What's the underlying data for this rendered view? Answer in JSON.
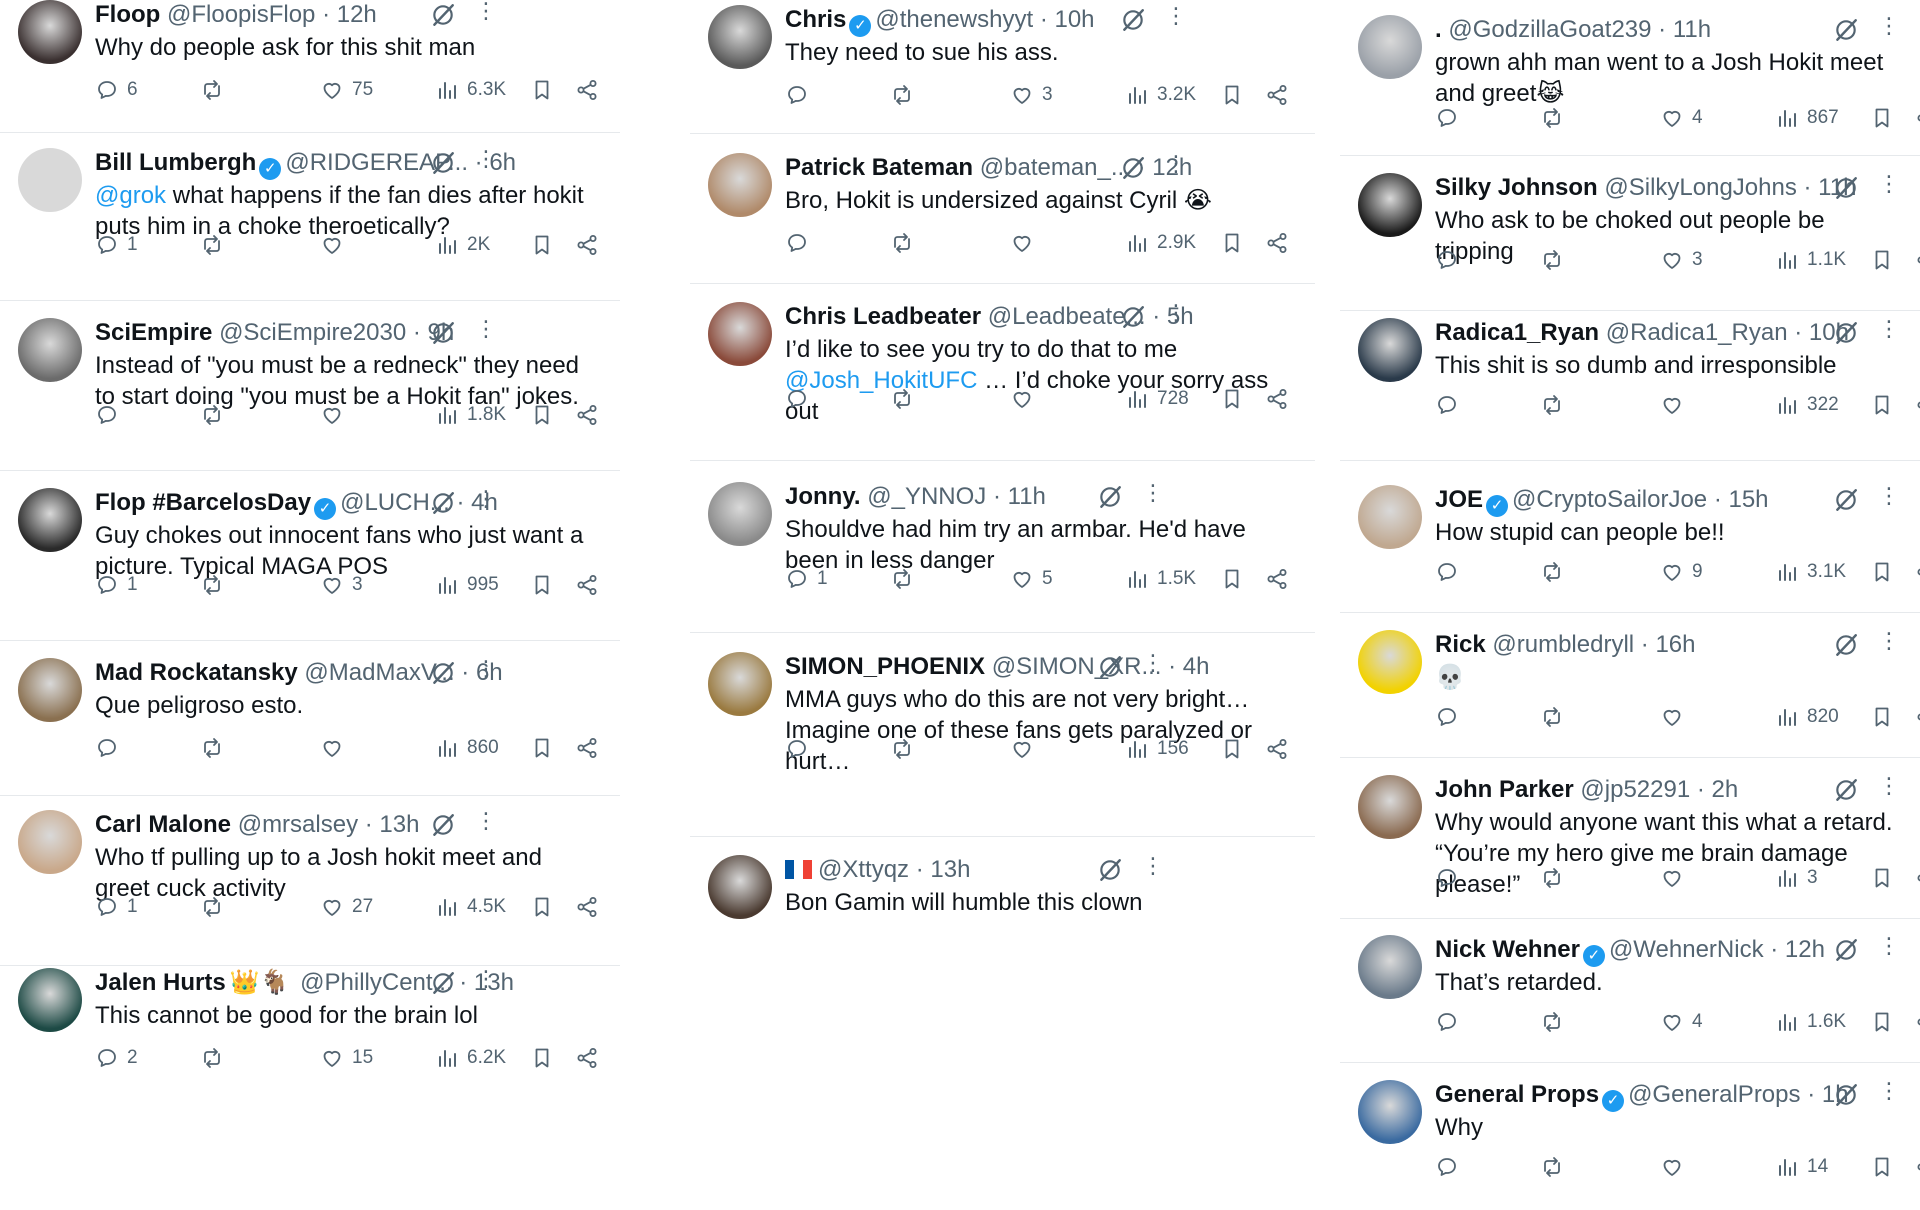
{
  "columns": [
    {
      "tweets": [
        {
          "name": "Floop",
          "verified": false,
          "extra": "",
          "handle": "@FloopisFlop",
          "time": "· 12h",
          "text": "Why do people ask for this shit man",
          "link": "",
          "text2": "",
          "replies": "6",
          "retweets": "",
          "likes": "75",
          "views": "6.3K",
          "avatar_color": "#3a3030"
        },
        {
          "name": "Bill Lumbergh",
          "verified": true,
          "extra": "",
          "handle": "@RIDGEREAP...",
          "time": "· 6h",
          "text": "",
          "link": "@grok",
          "text2": " what happens if the fan dies after hokit puts him in a choke theroetically?",
          "replies": "1",
          "retweets": "",
          "likes": "",
          "views": "2K",
          "avatar_color": "#d9d9d9"
        },
        {
          "name": "SciEmpire",
          "verified": false,
          "extra": "",
          "handle": "@SciEmpire2030",
          "time": "· 9h",
          "text": "Instead of \"you must be a redneck\" they need to start doing \"you must be a Hokit fan\" jokes.",
          "link": "",
          "text2": "",
          "replies": "",
          "retweets": "",
          "likes": "",
          "views": "1.8K",
          "avatar_color": "#6b6b6b"
        },
        {
          "name": "Flop #BarcelosDay",
          "verified": true,
          "extra": "",
          "handle": "@LUCH...",
          "time": "· 4h",
          "text": "Guy chokes out innocent fans who just want a picture. Typical MAGA POS",
          "link": "",
          "text2": "",
          "replies": "1",
          "retweets": "",
          "likes": "3",
          "views": "995",
          "avatar_color": "#2a2a2a"
        },
        {
          "name": "Mad Rockatansky",
          "verified": false,
          "extra": "",
          "handle": "@MadMaxV...",
          "time": "· 6h",
          "text": "Que peligroso esto.",
          "link": "",
          "text2": "",
          "replies": "",
          "retweets": "",
          "likes": "",
          "views": "860",
          "avatar_color": "#8a7050"
        },
        {
          "name": "Carl Malone",
          "verified": false,
          "extra": "",
          "handle": "@mrsalsey",
          "time": "· 13h",
          "text": "Who tf pulling up to a Josh hokit meet and greet cuck activity",
          "link": "",
          "text2": "",
          "replies": "1",
          "retweets": "",
          "likes": "27",
          "views": "4.5K",
          "avatar_color": "#c9a88a"
        },
        {
          "name": "Jalen Hurts",
          "verified": false,
          "extra": "👑🐐",
          "handle": "@PhillyCent...",
          "time": "· 13h",
          "text": "This cannot be good for the brain lol",
          "link": "",
          "text2": "",
          "replies": "2",
          "retweets": "",
          "likes": "15",
          "views": "6.2K",
          "avatar_color": "#1d4a45"
        }
      ]
    },
    {
      "tweets": [
        {
          "name": "Chris",
          "verified": true,
          "extra": "",
          "handle": "@thenewshyyt",
          "time": "· 10h",
          "text": "They need to sue his ass.",
          "link": "",
          "text2": "",
          "replies": "",
          "retweets": "",
          "likes": "3",
          "views": "3.2K",
          "avatar_color": "#5a5a5a"
        },
        {
          "name": "Patrick Bateman",
          "verified": false,
          "extra": "",
          "handle": "@bateman_...",
          "time": "· 12h",
          "text": "Bro, Hokit is undersized against Cyril 😭",
          "link": "",
          "text2": "",
          "replies": "",
          "retweets": "",
          "likes": "",
          "views": "2.9K",
          "avatar_color": "#b08a6a"
        },
        {
          "name": "Chris Leadbeater",
          "verified": false,
          "extra": "",
          "handle": "@Leadbeate...",
          "time": "· 5h",
          "text": "I’d like to see you try to do that to me ",
          "link": "@Josh_HokitUFC",
          "text2": " … I’d choke your sorry ass out",
          "replies": "",
          "retweets": "",
          "likes": "",
          "views": "728",
          "avatar_color": "#8a4a3a"
        },
        {
          "name": "Jonny.",
          "verified": false,
          "extra": "",
          "handle": "@_YNNOJ",
          "time": "· 11h",
          "text": "Shouldve had him try an armbar. He'd have been in less danger",
          "link": "",
          "text2": "",
          "replies": "1",
          "retweets": "",
          "likes": "5",
          "views": "1.5K",
          "avatar_color": "#8a8a8a"
        },
        {
          "name": "SIMON_PHOENIX",
          "verified": false,
          "extra": "",
          "handle": "@SIMON_XR...",
          "time": "· 4h",
          "text": "MMA guys who do this are not very bright…Imagine one of these fans gets paralyzed or hurt…",
          "link": "",
          "text2": "",
          "replies": "",
          "retweets": "",
          "likes": "",
          "views": "156",
          "avatar_color": "#9a7a40"
        },
        {
          "name": "",
          "verified": false,
          "extra": "",
          "handle": "@Xttyqz",
          "time": "· 13h",
          "text": "Bon Gamin will humble this clown",
          "link": "",
          "text2": "",
          "replies": "",
          "retweets": "",
          "likes": "",
          "views": "",
          "avatar_color": "#4a3a30"
        }
      ]
    },
    {
      "tweets": [
        {
          "name": ".",
          "verified": false,
          "extra": "",
          "handle": "@GodzillaGoat239",
          "time": "· 11h",
          "text": "grown ahh man went to a Josh Hokit meet and greet😹",
          "link": "",
          "text2": "",
          "replies": "",
          "retweets": "",
          "likes": "4",
          "views": "867",
          "avatar_color": "#9aa0a8"
        },
        {
          "name": "Silky Johnson",
          "verified": false,
          "extra": "",
          "handle": "@SilkyLongJohns",
          "time": "· 11h",
          "text": "Who ask to be choked out people be tripping",
          "link": "",
          "text2": "",
          "replies": "",
          "retweets": "",
          "likes": "3",
          "views": "1.1K",
          "avatar_color": "#1a1a1a"
        },
        {
          "name": "Radica1_Ryan",
          "verified": false,
          "extra": "",
          "handle": "@Radica1_Ryan",
          "time": "· 10h",
          "text": "This shit is so dumb and irresponsible",
          "link": "",
          "text2": "",
          "replies": "",
          "retweets": "",
          "likes": "",
          "views": "322",
          "avatar_color": "#2a3a4a"
        },
        {
          "name": "JOE",
          "verified": true,
          "extra": "",
          "handle": "@CryptoSailorJoe",
          "time": "· 15h",
          "text": "How stupid can people be!!",
          "link": "",
          "text2": "",
          "replies": "",
          "retweets": "",
          "likes": "9",
          "views": "3.1K",
          "avatar_color": "#c0a890"
        },
        {
          "name": "Rick",
          "verified": false,
          "extra": "",
          "handle": "@rumbledryll",
          "time": "· 16h",
          "text": "💀",
          "link": "",
          "text2": "",
          "replies": "",
          "retweets": "",
          "likes": "",
          "views": "820",
          "avatar_color": "#f2d200"
        },
        {
          "name": "John Parker",
          "verified": false,
          "extra": "",
          "handle": "@jp52291",
          "time": "· 2h",
          "text": "Why would anyone want this what a retard. “You’re my hero give me brain damage please!”",
          "link": "",
          "text2": "",
          "replies": "",
          "retweets": "",
          "likes": "",
          "views": "3",
          "avatar_color": "#8a6a50"
        },
        {
          "name": "Nick Wehner",
          "verified": true,
          "extra": "",
          "handle": "@WehnerNick",
          "time": "· 12h",
          "text": "That’s retarded.",
          "link": "",
          "text2": "",
          "replies": "",
          "retweets": "",
          "likes": "4",
          "views": "1.6K",
          "avatar_color": "#6a7a8a"
        },
        {
          "name": "General Props",
          "verified": true,
          "extra": "",
          "handle": "@GeneralProps",
          "time": "· 1h",
          "text": "Why",
          "link": "",
          "text2": "",
          "replies": "",
          "retweets": "",
          "likes": "",
          "views": "14",
          "avatar_color": "#3a6aa0"
        }
      ]
    }
  ],
  "colors": {
    "text": "#0f1419",
    "muted": "#536471",
    "link": "#1d9bf0",
    "verified": "#1d9bf0",
    "divider": "#e6e9ec"
  },
  "icons": [
    "reply-icon",
    "retweet-icon",
    "like-icon",
    "views-icon",
    "bookmark-icon",
    "share-icon",
    "grok-icon",
    "more-icon",
    "verified-icon"
  ]
}
